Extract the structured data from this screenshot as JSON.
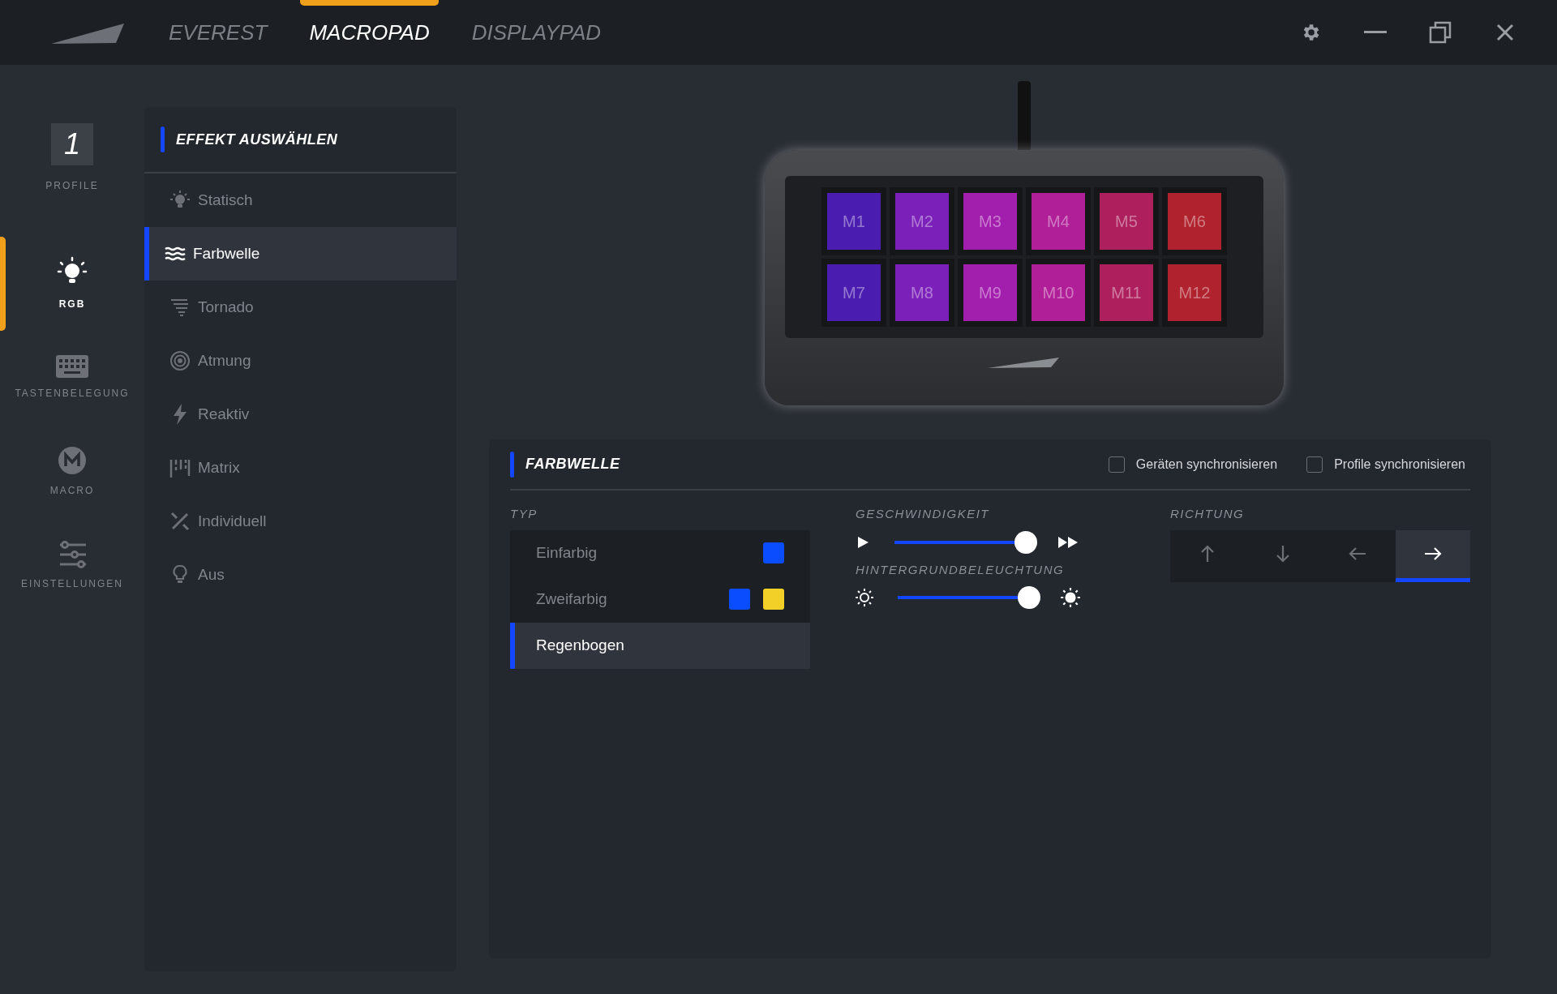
{
  "tabs": [
    {
      "label": "EVEREST",
      "selected": false
    },
    {
      "label": "MACROPAD",
      "selected": true
    },
    {
      "label": "DISPLAYPAD",
      "selected": false
    }
  ],
  "profile": {
    "number": "1",
    "label": "PROFILE"
  },
  "nav": [
    {
      "kind": "rgb",
      "label": "RGB",
      "selected": true
    },
    {
      "kind": "keyboard",
      "label": "TASTENBELEGUNG",
      "selected": false
    },
    {
      "kind": "macro",
      "label": "MACRO",
      "selected": false
    },
    {
      "kind": "settings",
      "label": "EINSTELLUNGEN",
      "selected": false
    }
  ],
  "effects": {
    "title": "EFFEKT AUSWÄHLEN",
    "items": [
      {
        "kind": "static",
        "label": "Statisch",
        "selected": false
      },
      {
        "kind": "wave",
        "label": "Farbwelle",
        "selected": true
      },
      {
        "kind": "tornado",
        "label": "Tornado",
        "selected": false
      },
      {
        "kind": "breath",
        "label": "Atmung",
        "selected": false
      },
      {
        "kind": "reactive",
        "label": "Reaktiv",
        "selected": false
      },
      {
        "kind": "matrix",
        "label": "Matrix",
        "selected": false
      },
      {
        "kind": "custom",
        "label": "Individuell",
        "selected": false
      },
      {
        "kind": "off",
        "label": "Aus",
        "selected": false
      }
    ]
  },
  "keys": [
    {
      "label": "M1",
      "color": "#4a1db0"
    },
    {
      "label": "M2",
      "color": "#7b20b8"
    },
    {
      "label": "M3",
      "color": "#a21fae"
    },
    {
      "label": "M4",
      "color": "#b01f98"
    },
    {
      "label": "M5",
      "color": "#ae1f5e"
    },
    {
      "label": "M6",
      "color": "#b0222e"
    },
    {
      "label": "M7",
      "color": "#4a1db0"
    },
    {
      "label": "M8",
      "color": "#7b20b8"
    },
    {
      "label": "M9",
      "color": "#a21fae"
    },
    {
      "label": "M10",
      "color": "#b01f98"
    },
    {
      "label": "M11",
      "color": "#ae1f5e"
    },
    {
      "label": "M12",
      "color": "#b0222e"
    }
  ],
  "settings": {
    "title": "FARBWELLE",
    "sync": [
      {
        "label": "Geräten synchronisieren",
        "checked": false
      },
      {
        "label": "Profile synchronisieren",
        "checked": false
      }
    ],
    "type": {
      "heading": "TYP",
      "options": [
        {
          "label": "Einfarbig",
          "selected": false,
          "swatches": [
            {
              "color": "#0a4dff"
            }
          ]
        },
        {
          "label": "Zweifarbig",
          "selected": false,
          "swatches": [
            {
              "color": "#0a4dff"
            },
            {
              "color": "#f3d027"
            }
          ]
        },
        {
          "label": "Regenbogen",
          "selected": true
        }
      ]
    },
    "speed": {
      "heading": "GESCHWINDIGKEIT",
      "level": 0.95
    },
    "backlight": {
      "heading": "HINTERGRUNDBELEUCHTUNG",
      "level": 0.95
    },
    "direction": {
      "heading": "RICHTUNG",
      "options": [
        {
          "kind": "up",
          "selected": false
        },
        {
          "kind": "down",
          "selected": false
        },
        {
          "kind": "left",
          "selected": false
        },
        {
          "kind": "right",
          "selected": true
        }
      ]
    }
  }
}
